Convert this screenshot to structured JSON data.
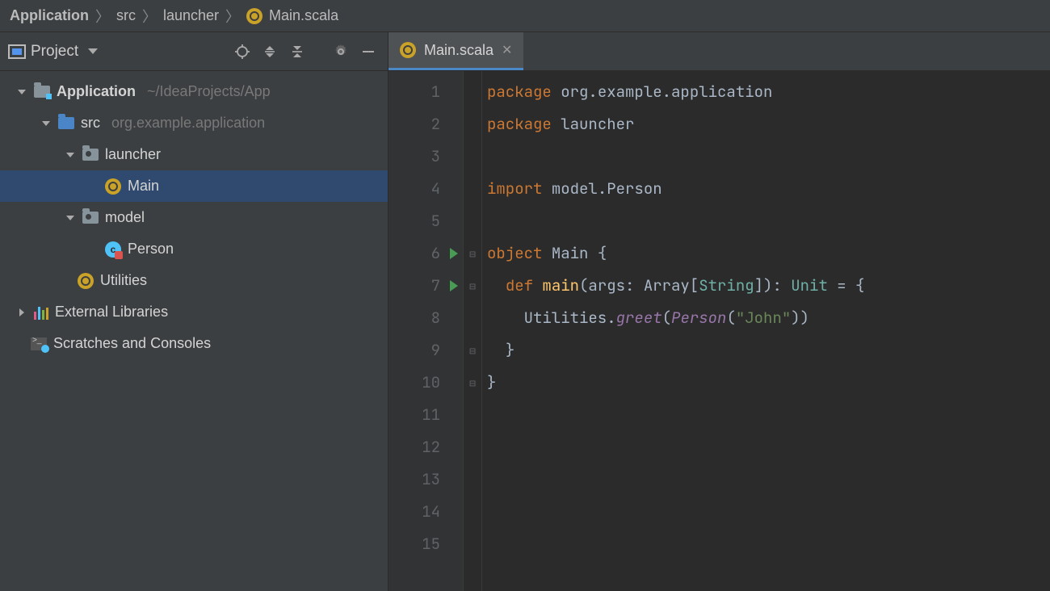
{
  "breadcrumb": {
    "items": [
      "Application",
      "src",
      "launcher",
      "Main.scala"
    ]
  },
  "toolbar": {
    "project_label": "Project"
  },
  "tab": {
    "label": "Main.scala"
  },
  "tree": {
    "app": {
      "name": "Application",
      "hint": "~/IdeaProjects/App"
    },
    "src": {
      "name": "src",
      "hint": "org.example.application"
    },
    "launcher": {
      "name": "launcher"
    },
    "main": {
      "name": "Main"
    },
    "model": {
      "name": "model"
    },
    "person": {
      "name": "Person"
    },
    "utilities": {
      "name": "Utilities"
    },
    "extlib": {
      "name": "External Libraries"
    },
    "scratch": {
      "name": "Scratches and Consoles"
    }
  },
  "editor": {
    "line_count": 15,
    "run_lines": [
      6,
      7
    ],
    "fold_lines": [
      6,
      7,
      9,
      10
    ],
    "code": {
      "l1": {
        "kw": "package",
        "rest": "org.example.application"
      },
      "l2": {
        "kw": "package",
        "rest": "launcher"
      },
      "l4": {
        "kw": "import",
        "rest": "model.Person"
      },
      "l6": {
        "kw": "object",
        "name": "Main",
        "brace": " {"
      },
      "l7": {
        "indent": "  ",
        "kw": "def",
        "name": "main",
        "sig1": "(args: Array[",
        "ty": "String",
        "sig2": "]): ",
        "ret": "Unit",
        "eq": " = {"
      },
      "l8": {
        "indent": "    ",
        "obj": "Utilities",
        "dot": ".",
        "mth": "greet",
        "p1": "(",
        "cls": "Person",
        "p2": "(",
        "str": "\"John\"",
        "p3": "))"
      },
      "l9": {
        "indent": "  ",
        "brace": "}"
      },
      "l10": {
        "brace": "}"
      }
    }
  }
}
